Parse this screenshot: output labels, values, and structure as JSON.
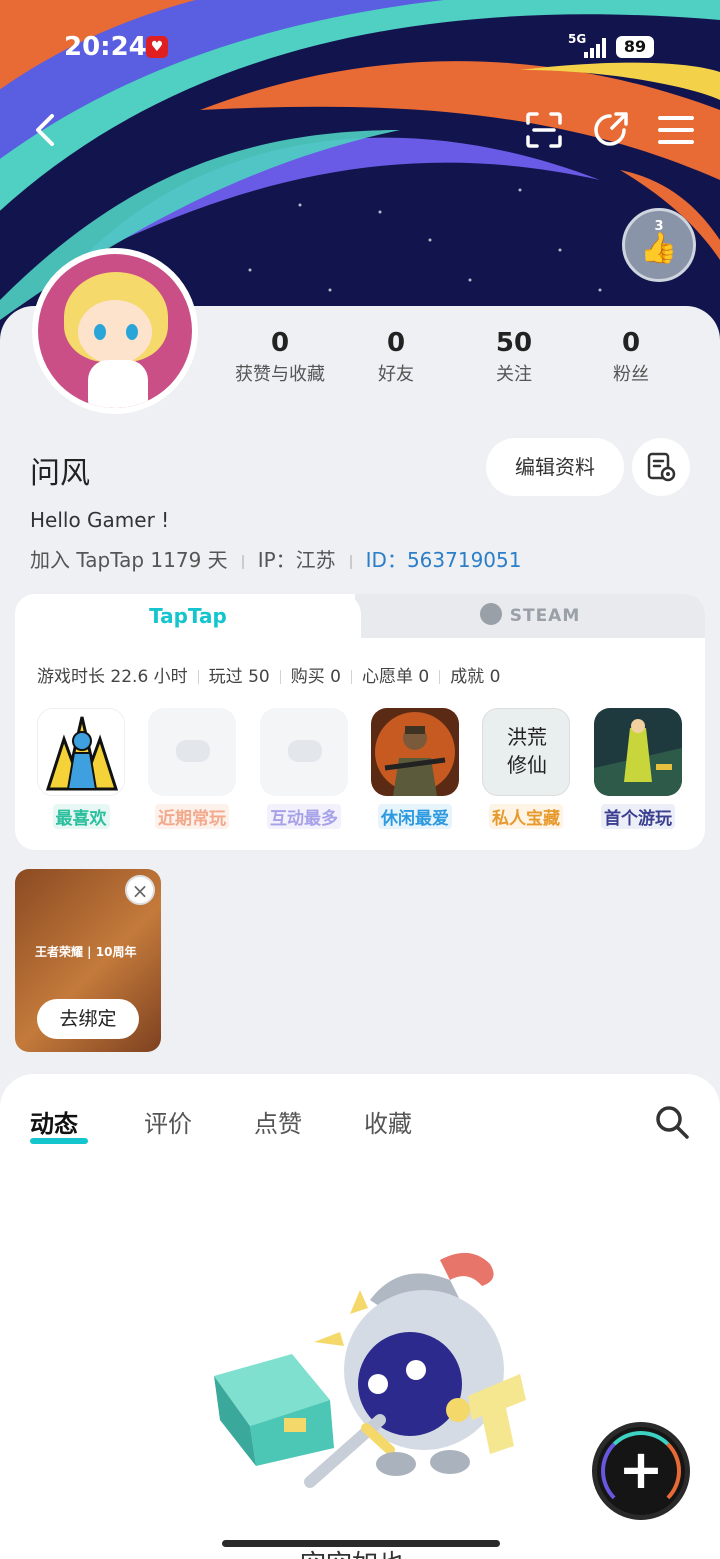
{
  "status_bar": {
    "time": "20:24",
    "network": "5G",
    "battery": "89"
  },
  "header": {
    "back": "back-icon",
    "scan": "scan-icon",
    "share": "share-icon",
    "menu": "menu-icon",
    "level_badge": "3"
  },
  "stats": [
    {
      "num": "0",
      "label": "获赞与收藏"
    },
    {
      "num": "0",
      "label": "好友"
    },
    {
      "num": "50",
      "label": "关注"
    },
    {
      "num": "0",
      "label": "粉丝"
    }
  ],
  "profile": {
    "name": "问风",
    "edit_label": "编辑资料",
    "bio": "Hello Gamer !",
    "joined": "加入 TapTap 1179 天",
    "ip": "IP：江苏",
    "id": "ID：563719051"
  },
  "game_card": {
    "tab_taptap": "TapTap",
    "tab_steam": "STEAM",
    "stats": [
      "游戏时长 22.6 小时",
      "玩过 50",
      "购买 0",
      "心愿单 0",
      "成就 0"
    ],
    "games": [
      {
        "tag": "最喜欢",
        "color": "#2bbf9d",
        "bg": "#e7f8f4"
      },
      {
        "tag": "近期常玩",
        "color": "#f2a98c",
        "bg": "#fdf1ec"
      },
      {
        "tag": "互动最多",
        "color": "#a7a2e8",
        "bg": "#f2f1fc"
      },
      {
        "tag": "休闲最爱",
        "color": "#2d9ae0",
        "bg": "#e8f4fc"
      },
      {
        "tag": "私人宝藏",
        "color": "#e79a2b",
        "bg": "#fdf4e6"
      },
      {
        "tag": "首个游玩",
        "color": "#3a3f8f",
        "bg": "#eceef8"
      }
    ],
    "game5_text": [
      "洪荒",
      "修仙"
    ]
  },
  "bind_card": {
    "brand": "王者荣耀 | 10周年",
    "button": "去绑定"
  },
  "content_tabs": [
    "动态",
    "评价",
    "点赞",
    "收藏"
  ],
  "empty_text": "空空如也",
  "colors": {
    "accent": "#15c5ce",
    "id_blue": "#2b7ec7"
  }
}
